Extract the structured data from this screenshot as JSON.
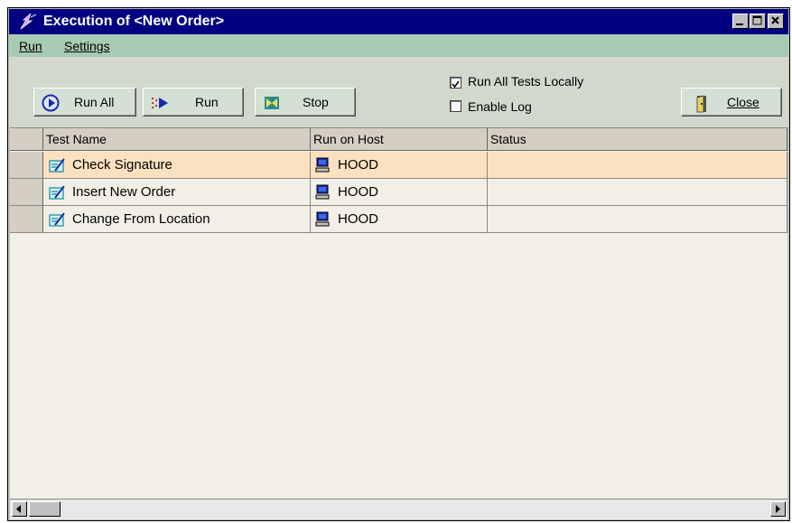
{
  "window": {
    "title": "Execution of <New Order>",
    "controls": [
      "minimize",
      "maximize",
      "close"
    ]
  },
  "menu": {
    "items": [
      "Run",
      "Settings"
    ]
  },
  "toolbar": {
    "run_all_label": "Run All",
    "run_label": "Run",
    "stop_label": "Stop",
    "close_label": "Close",
    "run_all_locally": {
      "label": "Run All Tests Locally",
      "checked": true
    },
    "enable_log": {
      "label": "Enable Log",
      "checked": false
    }
  },
  "table": {
    "columns": [
      "Test Name",
      "Run on Host",
      "Status"
    ],
    "rows": [
      {
        "name": "Check Signature",
        "host": "HOOD",
        "status": "",
        "selected": true
      },
      {
        "name": "Insert New Order",
        "host": "HOOD",
        "status": ""
      },
      {
        "name": "Change From Location",
        "host": "HOOD",
        "status": ""
      }
    ]
  },
  "colors": {
    "titlebar": "#000080",
    "menubar": "#a8cbb5",
    "selected_row": "#fbe1c0",
    "grid_background": "#f2f0e6"
  },
  "icons": [
    "app-lightning-icon",
    "play-circle-icon",
    "run-arrow-icon",
    "stop-icon",
    "exit-door-icon",
    "test-script-icon",
    "computer-icon"
  ]
}
